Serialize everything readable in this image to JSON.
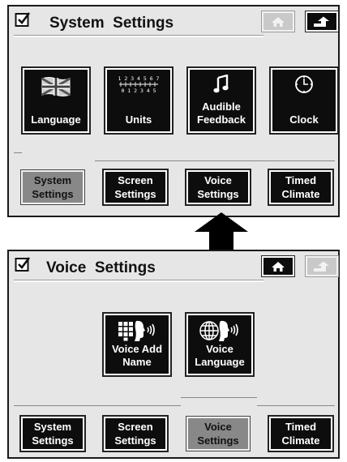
{
  "top_screen": {
    "title": "System  Settings",
    "tiles": [
      {
        "label": "Language",
        "icon": "flag-icon"
      },
      {
        "label": "Units",
        "icon": "ruler-scale-icon",
        "scale_top": "0 1 2 3 4 5 6 7 8",
        "scale_bottom": "0  1  2  3  4  5"
      },
      {
        "label": "Audible\nFeedback",
        "icon": "music-note-icon"
      },
      {
        "label": "Clock",
        "icon": "clock-icon"
      }
    ],
    "tabs": [
      {
        "label": "System\nSettings",
        "state": "selected"
      },
      {
        "label": "Screen\nSettings",
        "state": "normal"
      },
      {
        "label": "Voice\nSettings",
        "state": "normal"
      },
      {
        "label": "Timed\nClimate",
        "state": "normal"
      }
    ]
  },
  "bottom_screen": {
    "title": "Voice  Settings",
    "tiles": [
      {
        "label": "Voice Add\nName",
        "icon": "keypad-voice-icon"
      },
      {
        "label": "Voice\nLanguage",
        "icon": "globe-voice-icon"
      }
    ],
    "tabs": [
      {
        "label": "System\nSettings",
        "state": "normal"
      },
      {
        "label": "Screen\nSettings",
        "state": "normal"
      },
      {
        "label": "Voice\nSettings",
        "state": "selected"
      },
      {
        "label": "Timed\nClimate",
        "state": "normal"
      }
    ]
  },
  "colors": {
    "screen_bg": "#e6e6e6",
    "button_bg": "#0d0d0d",
    "selected_tab_bg": "#888888",
    "disabled_button_bg": "#c9c9c9"
  }
}
